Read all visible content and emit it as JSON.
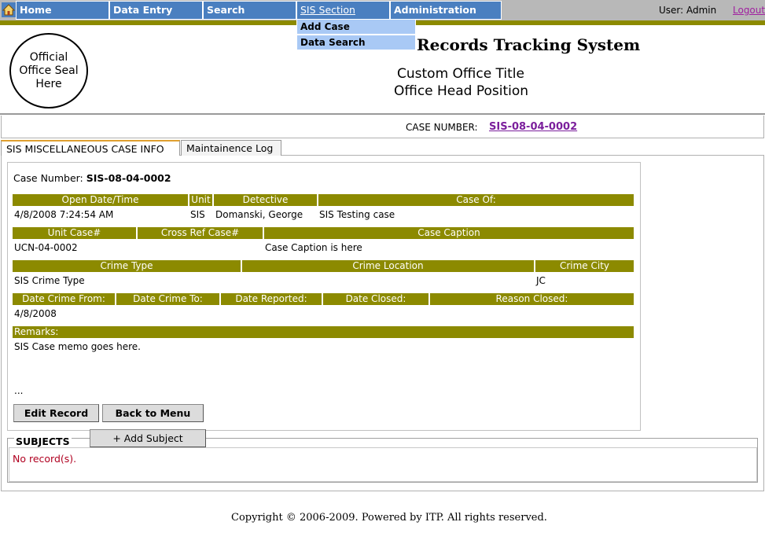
{
  "nav": {
    "items": [
      {
        "label": "Home"
      },
      {
        "label": "Data Entry"
      },
      {
        "label": "Search"
      },
      {
        "label": "SIS Section"
      },
      {
        "label": "Administration"
      }
    ],
    "user": "User: Admin",
    "logout": "Logout",
    "dropdown": [
      "Add Case",
      "Data Search"
    ]
  },
  "header": {
    "seal": "Official Office Seal Here",
    "system_title": "Records Tracking System",
    "office_title": "Custom Office Title",
    "office_head": "Office Head Position"
  },
  "casebar": {
    "label": "CASE NUMBER:",
    "number": "SIS-08-04-0002"
  },
  "tabs": [
    "SIS MISCELLANEOUS CASE INFO",
    "Maintainence Log"
  ],
  "case": {
    "number_label": "Case Number:",
    "number": "SIS-08-04-0002",
    "row1_headers": [
      "Open Date/Time",
      "Unit",
      "Detective",
      "Case Of:"
    ],
    "row1_values": [
      "4/8/2008 7:24:54 AM",
      "SIS",
      "Domanski, George",
      "SIS Testing case"
    ],
    "row2_headers": [
      "Unit Case#",
      "Cross Ref Case#",
      "Case Caption"
    ],
    "row2_values": [
      "UCN-04-0002",
      "",
      "Case Caption is here"
    ],
    "row3_headers": [
      "Crime Type",
      "Crime Location",
      "Crime City"
    ],
    "row3_values": [
      "SIS Crime Type",
      "",
      "JC"
    ],
    "row4_headers": [
      "Date Crime From:",
      "Date Crime To:",
      "Date Reported:",
      "Date Closed:",
      "Reason Closed:"
    ],
    "row4_values": [
      "4/8/2008",
      "",
      "",
      "",
      ""
    ],
    "remarks_header": "Remarks:",
    "remarks": "SIS Case memo goes here.",
    "ellipsis": "...",
    "edit_button": "Edit Record",
    "back_button": "Back to Menu"
  },
  "subjects": {
    "label": "SUBJECTS",
    "add_button": "+ Add Subject",
    "empty": "No record(s)."
  },
  "footer": {
    "copyright": "Copyright © 2006-2009. Powered by ITP.   All rights reserved."
  },
  "colors": {
    "nav_blue": "#4a7fc0",
    "olive": "#8c8a00",
    "dropdown": "#a9c9f5"
  }
}
